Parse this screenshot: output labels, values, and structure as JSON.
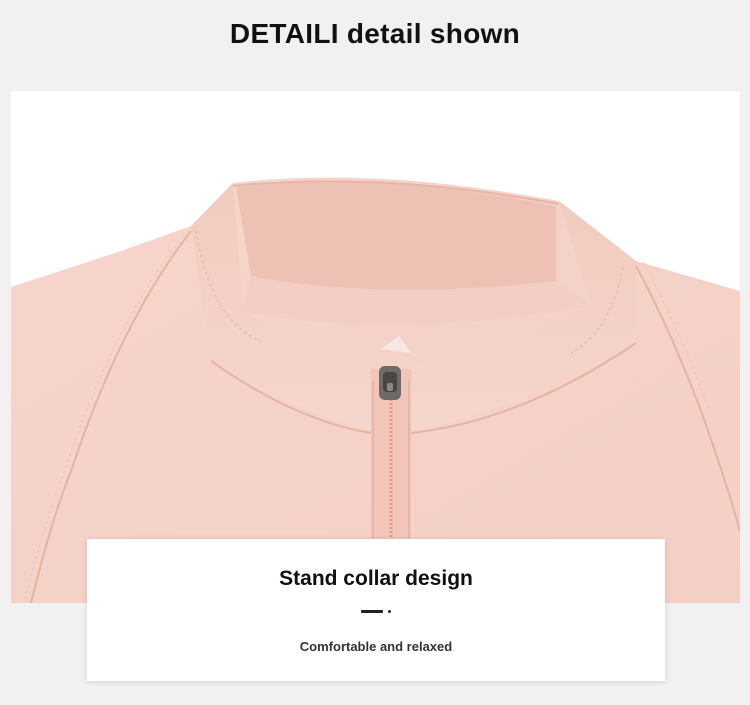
{
  "header": {
    "title": "DETAILI detail shown"
  },
  "photo": {
    "icon": "stand-collar-jacket-photo"
  },
  "caption": {
    "title": "Stand collar design",
    "subtitle": "Comfortable and relaxed"
  }
}
